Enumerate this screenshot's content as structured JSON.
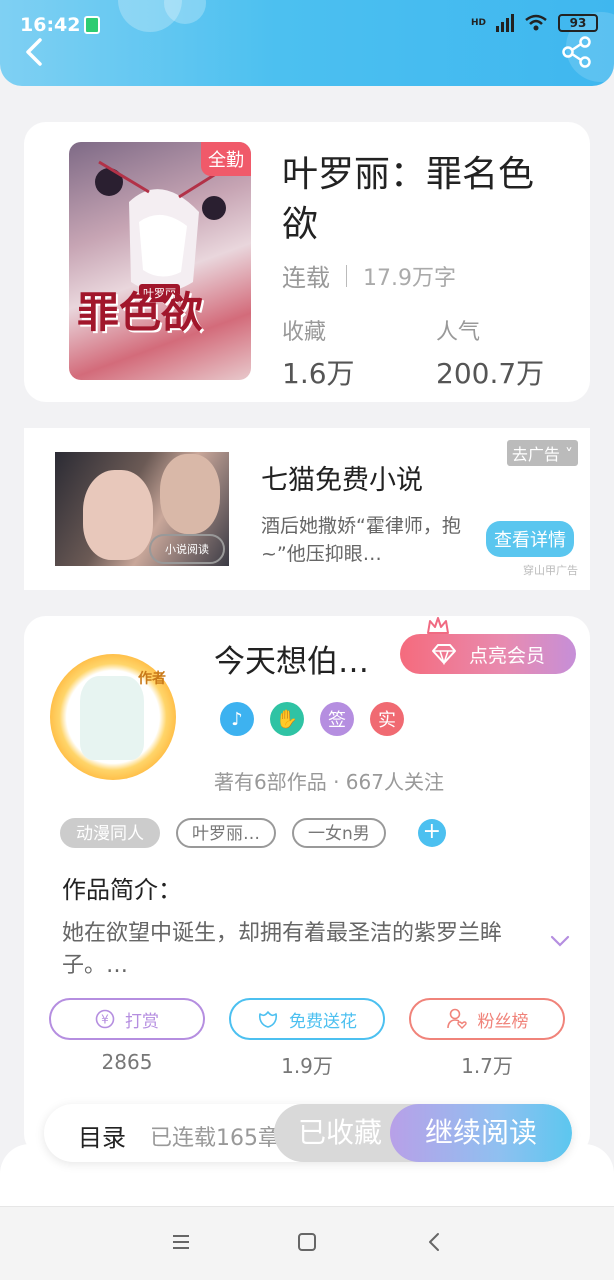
{
  "status_bar": {
    "time": "16:42",
    "battery": "93",
    "network": "HD"
  },
  "book": {
    "cover_badge": "全勤",
    "cover_title_art": "罪色欲",
    "cover_author_art": "叶罗丽",
    "title": "叶罗丽：罪名色欲",
    "status": "连载",
    "word_count": "17.9万字",
    "collect_label": "收藏",
    "collect_value": "1.6万",
    "popularity_label": "人气",
    "popularity_value": "200.7万"
  },
  "ad": {
    "title": "七猫免费小说",
    "description": "酒后她撒娇“霍律师，抱~”他压抑眼…",
    "remove_label": "去广告",
    "detail_button": "查看详情",
    "source": "穿山甲广告",
    "image_tag": "小说阅读"
  },
  "author": {
    "avatar_label": "作者",
    "name": "今天想伯…",
    "vip_button": "点亮会员",
    "badges": [
      {
        "icon": "music-badge-icon",
        "text": "",
        "color": "#3db2f0"
      },
      {
        "icon": "handshake-badge-icon",
        "text": "",
        "color": "#2fc3a4"
      },
      {
        "icon": "sign-badge-icon",
        "text": "签",
        "color": "#b58ee0"
      },
      {
        "icon": "real-badge-icon",
        "text": "实",
        "color": "#f06a72"
      }
    ],
    "stats": "著有6部作品 · 667人关注"
  },
  "tags": [
    "动漫同人",
    "叶罗丽…",
    "一女n男"
  ],
  "intro": {
    "title": "作品简介：",
    "text": "她在欲望中诞生，却拥有着最圣洁的紫罗兰眸子。…"
  },
  "actions": [
    {
      "label": "打赏",
      "count": "2865",
      "color": "#b58ee0"
    },
    {
      "label": "免费送花",
      "count": "1.9万",
      "color": "#4cc0f0"
    },
    {
      "label": "粉丝榜",
      "count": "1.7万",
      "color": "#f0837a"
    }
  ],
  "bottom_bar": {
    "toc_label": "目录",
    "toc_status": "已连载165章",
    "collected_label": "已收藏",
    "read_label": "继续阅读"
  }
}
